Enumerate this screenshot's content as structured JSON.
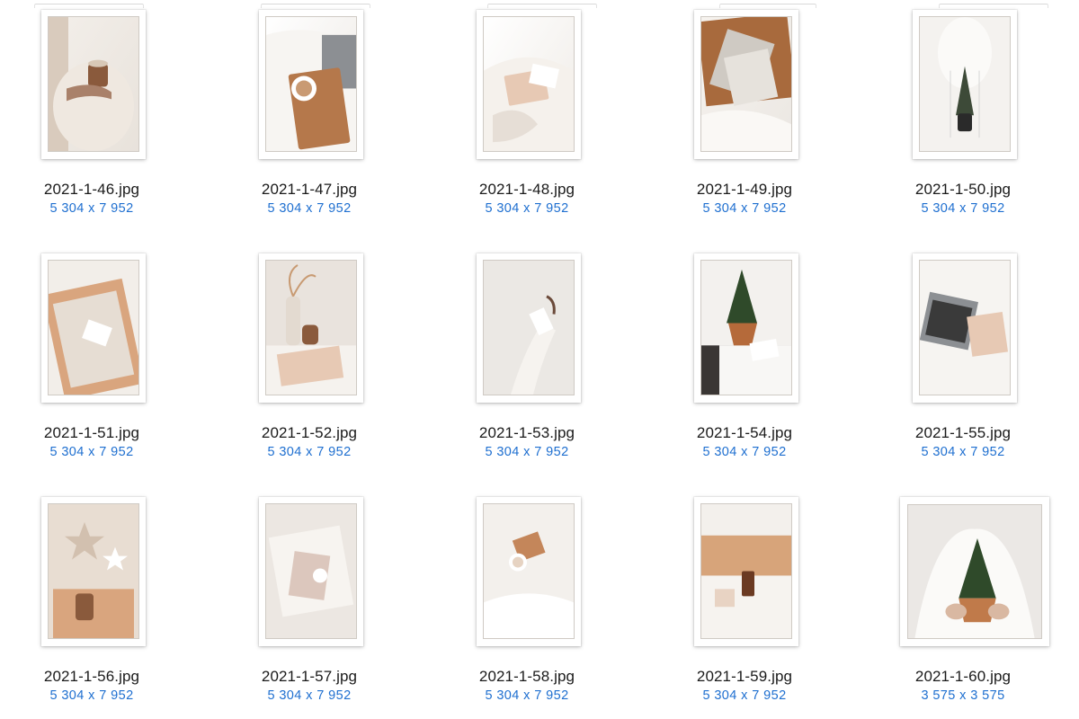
{
  "files": [
    {
      "name": "2021-1-46.jpg",
      "dimensions": "5 304 x 7 952",
      "orientation": "portrait",
      "icon": "photo-coffee-cup-thumbnail",
      "palette": [
        "#e8e2db",
        "#d9cbbd",
        "#8a5a3c",
        "#f3efea"
      ]
    },
    {
      "name": "2021-1-47.jpg",
      "dimensions": "5 304 x 7 952",
      "orientation": "portrait",
      "icon": "photo-laptop-tray-thumbnail",
      "palette": [
        "#ece8e3",
        "#b5784b",
        "#8c8f93",
        "#ffffff"
      ]
    },
    {
      "name": "2021-1-48.jpg",
      "dimensions": "5 304 x 7 952",
      "orientation": "portrait",
      "icon": "photo-gift-lap-thumbnail",
      "palette": [
        "#efebe6",
        "#e7c9b4",
        "#d7ccc2",
        "#ffffff"
      ]
    },
    {
      "name": "2021-1-49.jpg",
      "dimensions": "5 304 x 7 952",
      "orientation": "portrait",
      "icon": "photo-envelopes-tray-thumbnail",
      "palette": [
        "#ebe7e2",
        "#a86a3d",
        "#cfcac3",
        "#f6f3ef"
      ]
    },
    {
      "name": "2021-1-50.jpg",
      "dimensions": "5 304 x 7 952",
      "orientation": "portrait",
      "icon": "photo-tree-glass-thumbnail",
      "palette": [
        "#f1eeea",
        "#3d4a38",
        "#2a2a2a",
        "#ffffff"
      ]
    },
    {
      "name": "2021-1-51.jpg",
      "dimensions": "5 304 x 7 952",
      "orientation": "portrait",
      "icon": "photo-wooden-box-thumbnail",
      "palette": [
        "#efebe6",
        "#d9a57e",
        "#e6ddd3",
        "#f6f3ef"
      ]
    },
    {
      "name": "2021-1-52.jpg",
      "dimensions": "5 304 x 7 952",
      "orientation": "portrait",
      "icon": "photo-vase-envelopes-thumbnail",
      "palette": [
        "#ece6e0",
        "#c89a72",
        "#8a5a3c",
        "#e7c9b4"
      ]
    },
    {
      "name": "2021-1-53.jpg",
      "dimensions": "5 304 x 7 952",
      "orientation": "portrait",
      "icon": "photo-hand-tag-thumbnail",
      "palette": [
        "#e6e3de",
        "#f6f3ef",
        "#6b4a3a",
        "#d7ccc2"
      ]
    },
    {
      "name": "2021-1-54.jpg",
      "dimensions": "5 304 x 7 952",
      "orientation": "portrait",
      "icon": "photo-tree-copper-pot-thumbnail",
      "palette": [
        "#efece8",
        "#2f4a2a",
        "#b56a3a",
        "#3a3634"
      ]
    },
    {
      "name": "2021-1-55.jpg",
      "dimensions": "5 304 x 7 952",
      "orientation": "portrait",
      "icon": "photo-laptop-bed-thumbnail",
      "palette": [
        "#eeeae6",
        "#8c8f93",
        "#3a3a3a",
        "#e7c9b4"
      ]
    },
    {
      "name": "2021-1-56.jpg",
      "dimensions": "5 304 x 7 952",
      "orientation": "portrait",
      "icon": "photo-star-shadow-box-thumbnail",
      "palette": [
        "#e8ddd2",
        "#c9b3a0",
        "#8a5a3c",
        "#f3ece4"
      ]
    },
    {
      "name": "2021-1-57.jpg",
      "dimensions": "5 304 x 7 952",
      "orientation": "portrait",
      "icon": "photo-gift-box-sheets-thumbnail",
      "palette": [
        "#e9e4df",
        "#dcc7bd",
        "#f6f3ef",
        "#c7b6ab"
      ]
    },
    {
      "name": "2021-1-58.jpg",
      "dimensions": "5 304 x 7 952",
      "orientation": "portrait",
      "icon": "photo-mug-gift-hands-thumbnail",
      "palette": [
        "#efebe6",
        "#c4865a",
        "#f6f3ef",
        "#d7ccc2"
      ]
    },
    {
      "name": "2021-1-59.jpg",
      "dimensions": "5 304 x 7 952",
      "orientation": "portrait",
      "icon": "photo-wood-crate-bottle-thumbnail",
      "palette": [
        "#efebe6",
        "#d7a47a",
        "#6b3a22",
        "#f6f3ef"
      ]
    },
    {
      "name": "2021-1-60.jpg",
      "dimensions": "3 575 x 3 575",
      "orientation": "square",
      "icon": "photo-tree-hands-square-thumbnail",
      "palette": [
        "#e9e6e2",
        "#2f4a2a",
        "#c07a4a",
        "#ffffff"
      ]
    }
  ]
}
